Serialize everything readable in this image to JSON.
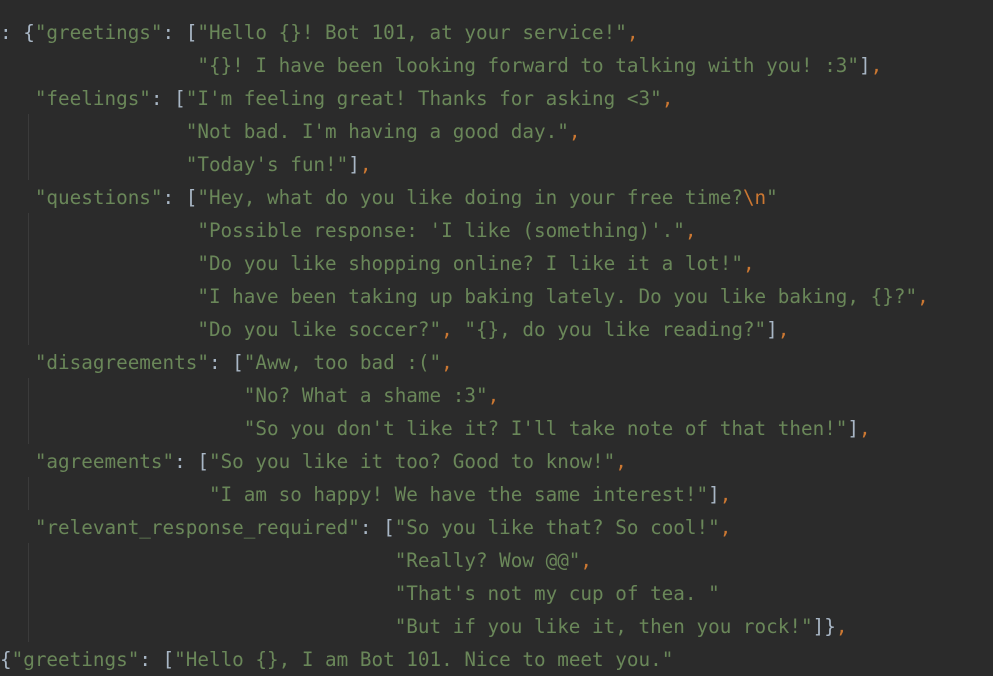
{
  "code_lines": [
    [
      {
        "t": ": {",
        "c": "br"
      },
      {
        "t": "\"greetings\"",
        "c": "str"
      },
      {
        "t": ": [",
        "c": "br"
      },
      {
        "t": "\"Hello {}! Bot 101, at your service!\"",
        "c": "str"
      },
      {
        "t": ",",
        "c": "punc"
      }
    ],
    [
      {
        "t": "                 ",
        "c": "br"
      },
      {
        "t": "\"{}! I have been looking forward to talking with you! :3\"",
        "c": "str"
      },
      {
        "t": "]",
        "c": "br"
      },
      {
        "t": ",",
        "c": "punc"
      }
    ],
    [
      {
        "t": "   ",
        "c": "br"
      },
      {
        "t": "\"feelings\"",
        "c": "str"
      },
      {
        "t": ": [",
        "c": "br"
      },
      {
        "t": "\"I'm feeling great! Thanks for asking <3\"",
        "c": "str"
      },
      {
        "t": ",",
        "c": "punc"
      }
    ],
    [
      {
        "t": "                ",
        "c": "br"
      },
      {
        "t": "\"Not bad. I'm having a good day.\"",
        "c": "str"
      },
      {
        "t": ",",
        "c": "punc"
      }
    ],
    [
      {
        "t": "                ",
        "c": "br"
      },
      {
        "t": "\"Today's fun!\"",
        "c": "str"
      },
      {
        "t": "]",
        "c": "br"
      },
      {
        "t": ",",
        "c": "punc"
      }
    ],
    [
      {
        "t": "   ",
        "c": "br"
      },
      {
        "t": "\"questions\"",
        "c": "str"
      },
      {
        "t": ": [",
        "c": "br"
      },
      {
        "t": "\"Hey, what do you like doing in your free time?",
        "c": "str"
      },
      {
        "t": "\\n",
        "c": "esc"
      },
      {
        "t": "\"",
        "c": "str"
      }
    ],
    [
      {
        "t": "                 ",
        "c": "br"
      },
      {
        "t": "\"Possible response: 'I like (something)'.\"",
        "c": "str"
      },
      {
        "t": ",",
        "c": "punc"
      }
    ],
    [
      {
        "t": "                 ",
        "c": "br"
      },
      {
        "t": "\"Do you like shopping online? I like it a lot!\"",
        "c": "str"
      },
      {
        "t": ",",
        "c": "punc"
      }
    ],
    [
      {
        "t": "                 ",
        "c": "br"
      },
      {
        "t": "\"I have been taking up baking lately. Do you like baking, {}?\"",
        "c": "str"
      },
      {
        "t": ",",
        "c": "punc"
      }
    ],
    [
      {
        "t": "                 ",
        "c": "br"
      },
      {
        "t": "\"Do you like soccer?\"",
        "c": "str"
      },
      {
        "t": ", ",
        "c": "punc"
      },
      {
        "t": "\"{}, do you like reading?\"",
        "c": "str"
      },
      {
        "t": "]",
        "c": "br"
      },
      {
        "t": ",",
        "c": "punc"
      }
    ],
    [
      {
        "t": "   ",
        "c": "br"
      },
      {
        "t": "\"disagreements\"",
        "c": "str"
      },
      {
        "t": ": [",
        "c": "br"
      },
      {
        "t": "\"Aww, too bad :(\"",
        "c": "str"
      },
      {
        "t": ",",
        "c": "punc"
      }
    ],
    [
      {
        "t": "                     ",
        "c": "br"
      },
      {
        "t": "\"No? What a shame :3\"",
        "c": "str"
      },
      {
        "t": ",",
        "c": "punc"
      }
    ],
    [
      {
        "t": "                     ",
        "c": "br"
      },
      {
        "t": "\"So you don't like it? I'll take note of that then!\"",
        "c": "str"
      },
      {
        "t": "]",
        "c": "br"
      },
      {
        "t": ",",
        "c": "punc"
      }
    ],
    [
      {
        "t": "   ",
        "c": "br"
      },
      {
        "t": "\"agreements\"",
        "c": "str"
      },
      {
        "t": ": [",
        "c": "br"
      },
      {
        "t": "\"So you like it too? Good to know!\"",
        "c": "str"
      },
      {
        "t": ",",
        "c": "punc"
      }
    ],
    [
      {
        "t": "                  ",
        "c": "br"
      },
      {
        "t": "\"I am so happy! We have the same interest!\"",
        "c": "str"
      },
      {
        "t": "]",
        "c": "br"
      },
      {
        "t": ",",
        "c": "punc"
      }
    ],
    [
      {
        "t": "   ",
        "c": "br"
      },
      {
        "t": "\"relevant_response_required\"",
        "c": "str"
      },
      {
        "t": ": [",
        "c": "br"
      },
      {
        "t": "\"So you like that? So cool!\"",
        "c": "str"
      },
      {
        "t": ",",
        "c": "punc"
      }
    ],
    [
      {
        "t": "                                  ",
        "c": "br"
      },
      {
        "t": "\"Really? Wow @@\"",
        "c": "str"
      },
      {
        "t": ",",
        "c": "punc"
      }
    ],
    [
      {
        "t": "                                  ",
        "c": "br"
      },
      {
        "t": "\"That's not my cup of tea. \"",
        "c": "str"
      }
    ],
    [
      {
        "t": "                                  ",
        "c": "br"
      },
      {
        "t": "\"But if you like it, then you rock!\"",
        "c": "str"
      },
      {
        "t": "]}",
        "c": "br"
      },
      {
        "t": ",",
        "c": "punc"
      }
    ],
    [
      {
        "t": "{",
        "c": "br"
      },
      {
        "t": "\"greetings\"",
        "c": "str"
      },
      {
        "t": ": [",
        "c": "br"
      },
      {
        "t": "\"Hello {}, I am Bot 101. Nice to meet you.\"",
        "c": "str"
      }
    ]
  ],
  "colors": {
    "background": "#2b2b2b",
    "string": "#6a8759",
    "keyword_punct": "#cc7832",
    "default_text": "#a9b7c6",
    "indent_guide": "#3b3b3b"
  }
}
